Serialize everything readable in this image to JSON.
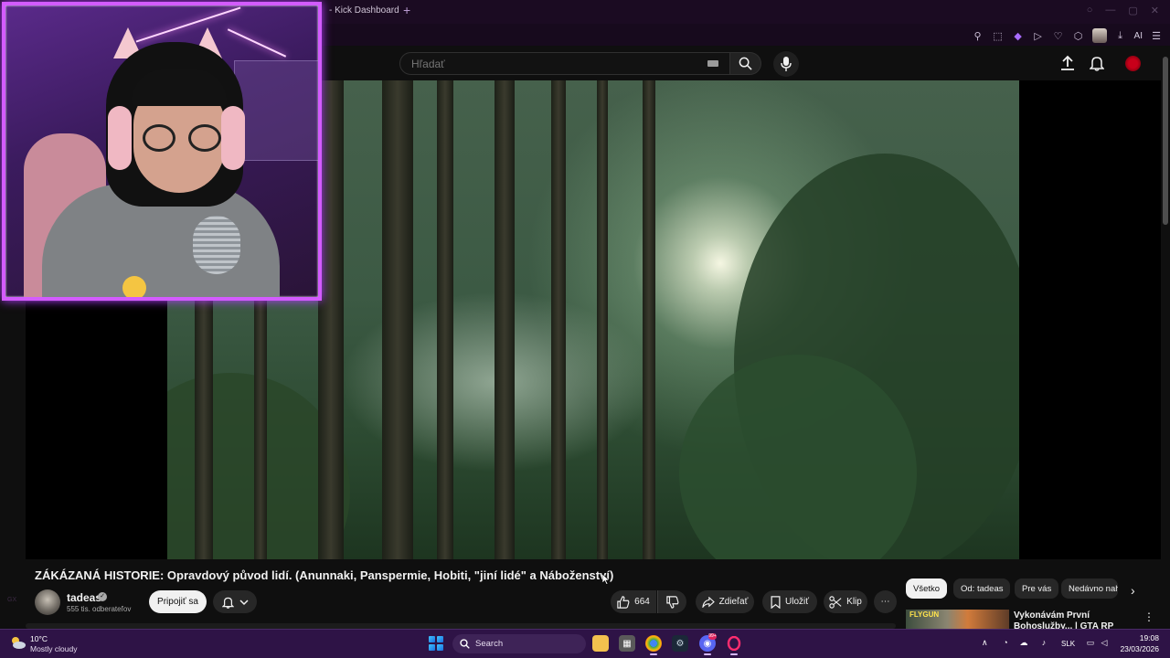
{
  "browser": {
    "tab_title": "- Kick Dashboard",
    "new_tab": "+",
    "ai_label": "AI"
  },
  "header": {
    "search_placeholder": "Hľadať"
  },
  "video": {
    "title": "ZÁKÁZANÁ HISTORIE: Opravdový původ lidí. (Anunnaki, Panspermie, Hobiti, \"jiní lidé\" a Náboženství)",
    "channel_name": "tadeas",
    "verified": "✓",
    "subscribers": "555 tis. odberateľov",
    "join_label": "Pripojiť sa",
    "likes": "664",
    "share_label": "Zdieľať",
    "save_label": "Uložiť",
    "clip_label": "Klip",
    "more": "⋯"
  },
  "chips": {
    "all": "Všetko",
    "from": "Od: tadeas",
    "for_you": "Pre vás",
    "recent": "Nedávno nah",
    "next": "›"
  },
  "recommendation": {
    "thumb_label": "FLYGUN",
    "title": "Vykonávám První Bohoslužby... | GTA RP",
    "more": "⋮"
  },
  "left_rail": {
    "tag": "GX"
  },
  "taskbar": {
    "temperature": "10°C",
    "weather": "Mostly cloudy",
    "search_label": "Search",
    "notif_count": "99+",
    "language": "SLK",
    "time": "19:08",
    "date": "23/03/2026"
  },
  "colors": {
    "accent_purple": "#d35bff",
    "taskbar_bg": "#2e1346",
    "yt_bg": "#0f0f0f"
  }
}
